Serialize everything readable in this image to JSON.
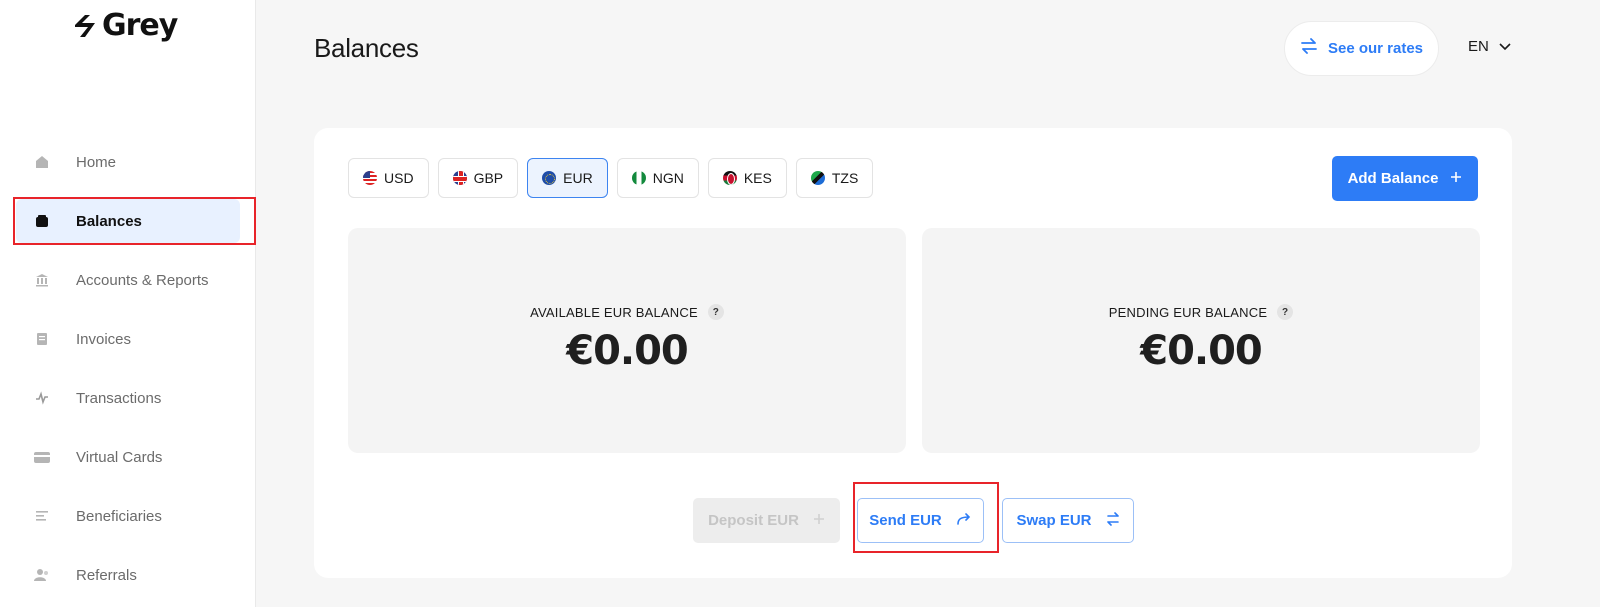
{
  "brand": {
    "name": "Grey"
  },
  "sidebar": {
    "items": [
      {
        "label": "Home",
        "icon": "home-icon"
      },
      {
        "label": "Balances",
        "icon": "wallet-icon",
        "active": true
      },
      {
        "label": "Accounts & Reports",
        "icon": "bank-icon"
      },
      {
        "label": "Invoices",
        "icon": "invoice-icon"
      },
      {
        "label": "Transactions",
        "icon": "activity-icon"
      },
      {
        "label": "Virtual Cards",
        "icon": "card-icon"
      },
      {
        "label": "Beneficiaries",
        "icon": "list-icon"
      },
      {
        "label": "Referrals",
        "icon": "users-icon"
      }
    ]
  },
  "header": {
    "title": "Balances",
    "rates_label": "See our rates",
    "language": "EN"
  },
  "currency_tabs": [
    {
      "code": "USD",
      "flag": "us-flag-icon"
    },
    {
      "code": "GBP",
      "flag": "uk-flag-icon"
    },
    {
      "code": "EUR",
      "flag": "eu-flag-icon",
      "selected": true
    },
    {
      "code": "NGN",
      "flag": "ng-flag-icon"
    },
    {
      "code": "KES",
      "flag": "ke-flag-icon"
    },
    {
      "code": "TZS",
      "flag": "tz-flag-icon"
    }
  ],
  "add_balance_label": "Add Balance",
  "balances": {
    "available": {
      "caption": "AVAILABLE EUR BALANCE",
      "amount": "€0.00"
    },
    "pending": {
      "caption": "PENDING EUR BALANCE",
      "amount": "€0.00"
    },
    "help_symbol": "?"
  },
  "actions": {
    "deposit": "Deposit EUR",
    "send": "Send EUR",
    "swap": "Swap EUR"
  },
  "colors": {
    "accent": "#2d7cf6",
    "highlight": "#e8242a",
    "active_nav_bg": "#e8f1ff"
  }
}
